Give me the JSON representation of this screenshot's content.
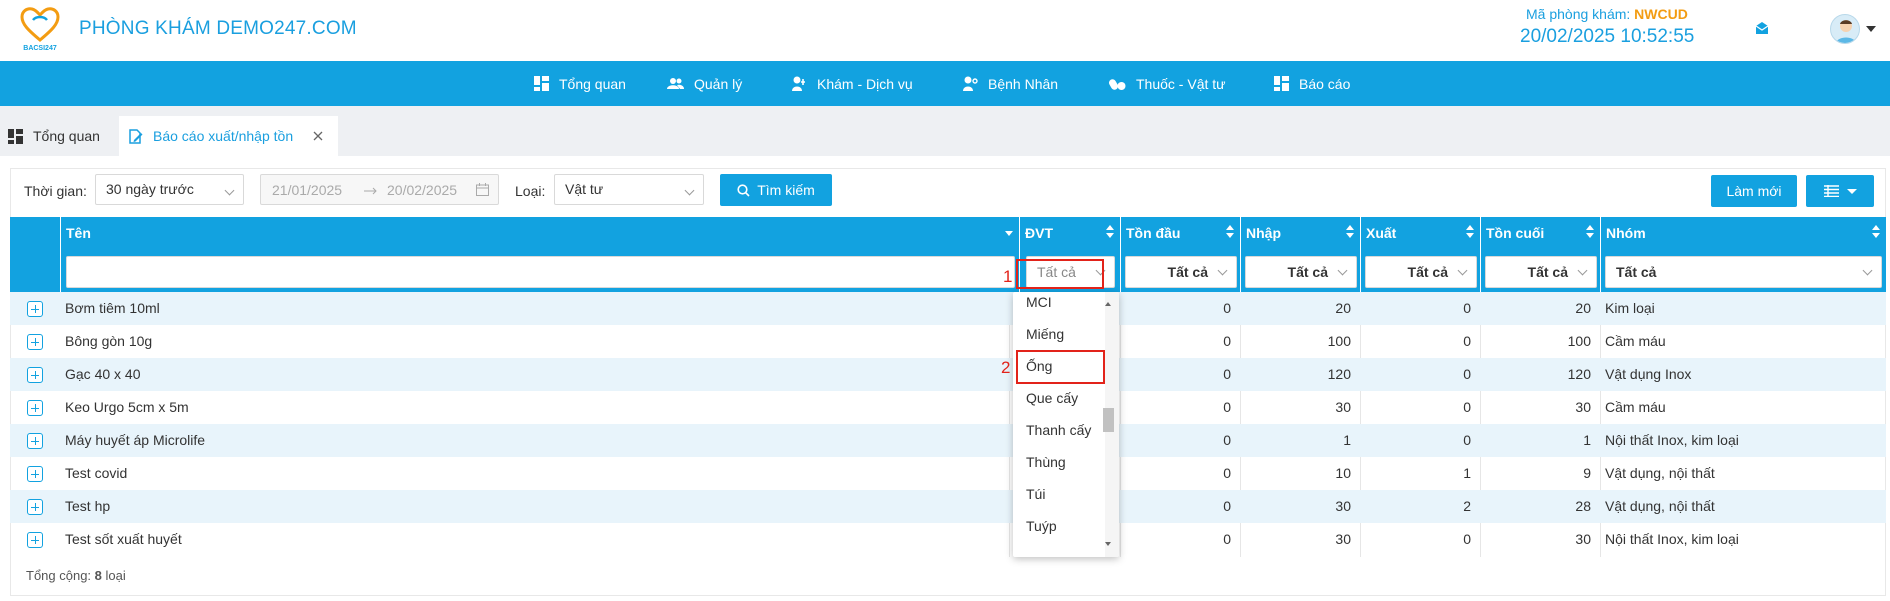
{
  "header": {
    "brand": "PHÒNG KHÁM DEMO247.COM",
    "clinic_code_label": "Mã phòng khám: ",
    "clinic_code_value": "NWCUD",
    "datetime": "20/02/2025 10:52:55",
    "logo_text": "BACSI247"
  },
  "nav": {
    "items": [
      {
        "label": "Tổng quan",
        "icon": "dashboard-icon"
      },
      {
        "label": "Quản lý",
        "icon": "users-icon"
      },
      {
        "label": "Khám - Dịch vụ",
        "icon": "stethoscope-icon"
      },
      {
        "label": "Bệnh Nhân",
        "icon": "patient-icon"
      },
      {
        "label": "Thuốc - Vật tư",
        "icon": "pills-icon"
      },
      {
        "label": "Báo cáo",
        "icon": "report-icon"
      }
    ]
  },
  "tabs": [
    {
      "label": "Tổng quan",
      "active": false
    },
    {
      "label": "Báo cáo xuất/nhập tồn",
      "active": true
    }
  ],
  "filters": {
    "time_label": "Thời gian:",
    "time_value": "30 ngày trước",
    "date_from": "21/01/2025",
    "date_to": "20/02/2025",
    "type_label": "Loại:",
    "type_value": "Vật tư",
    "search_button": "Tìm kiếm",
    "refresh_button": "Làm mới"
  },
  "table": {
    "columns": [
      "Tên",
      "ĐVT",
      "Tồn đầu",
      "Nhập",
      "Xuất",
      "Tồn cuối",
      "Nhóm"
    ],
    "filter_all": "Tất cả",
    "rows": [
      {
        "name": "Bơm tiêm 10ml",
        "ton_dau": "0",
        "nhap": "20",
        "xuat": "0",
        "ton_cuoi": "20",
        "nhom": "Kim loại"
      },
      {
        "name": "Bông gòn 10g",
        "ton_dau": "0",
        "nhap": "100",
        "xuat": "0",
        "ton_cuoi": "100",
        "nhom": "Cầm máu"
      },
      {
        "name": "Gạc 40 x 40",
        "ton_dau": "0",
        "nhap": "120",
        "xuat": "0",
        "ton_cuoi": "120",
        "nhom": "Vật dụng Inox"
      },
      {
        "name": "Keo Urgo 5cm x 5m",
        "ton_dau": "0",
        "nhap": "30",
        "xuat": "0",
        "ton_cuoi": "30",
        "nhom": "Cầm máu"
      },
      {
        "name": "Máy huyết áp Microlife",
        "ton_dau": "0",
        "nhap": "1",
        "xuat": "0",
        "ton_cuoi": "1",
        "nhom": "Nội thất Inox, kim loại"
      },
      {
        "name": "Test covid",
        "ton_dau": "0",
        "nhap": "10",
        "xuat": "1",
        "ton_cuoi": "9",
        "nhom": "Vật dụng, nội thất"
      },
      {
        "name": "Test hp",
        "ton_dau": "0",
        "nhap": "30",
        "xuat": "2",
        "ton_cuoi": "28",
        "nhom": "Vật dụng, nội thất"
      },
      {
        "name": "Test sốt xuất huyết",
        "ton_dau": "0",
        "nhap": "30",
        "xuat": "0",
        "ton_cuoi": "30",
        "nhom": "Nội thất Inox, kim loại"
      }
    ],
    "footer_label": "Tổng cộng: ",
    "footer_count": "8",
    "footer_unit": " loại"
  },
  "dropdown": {
    "options": [
      "MCI",
      "Miếng",
      "Ống",
      "Que cấy",
      "Thanh cấy",
      "Thùng",
      "Túi",
      "Tuýp"
    ]
  },
  "annotations": {
    "step1": "1",
    "step2": "2"
  },
  "colors": {
    "primary": "#12a2e0",
    "accent_orange": "#f39c12",
    "annotation_red": "#e2231a",
    "row_alt": "#e8f4fb"
  }
}
